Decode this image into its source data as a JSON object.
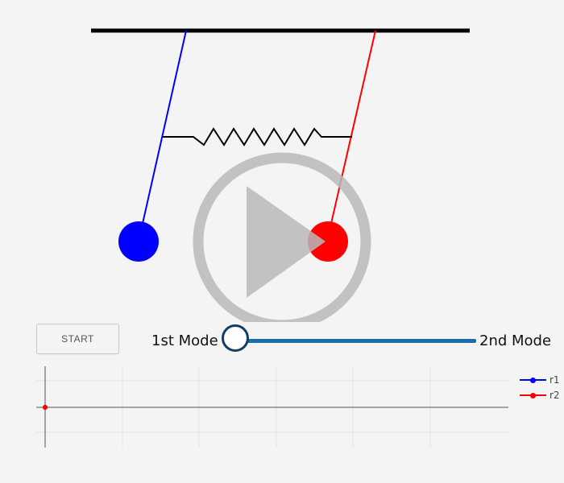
{
  "colors": {
    "background": "#f4f4f4",
    "pendulum_1": "#0000ff",
    "pendulum_2": "#ff0000",
    "spring": "#000000",
    "ceiling": "#000000",
    "play_overlay": "#b9b9b9",
    "slider_track": "#1a6ea8",
    "slider_thumb_border": "#123e66"
  },
  "icons": {
    "play": "play-icon"
  },
  "controls": {
    "start_label": "START",
    "mode_left_label": "1st Mode",
    "mode_right_label": "2nd Mode",
    "mode_slider_value": 0
  },
  "plot": {
    "legend": [
      {
        "name": "r1",
        "color": "#0000ff"
      },
      {
        "name": "r2",
        "color": "#ff0000"
      }
    ]
  }
}
